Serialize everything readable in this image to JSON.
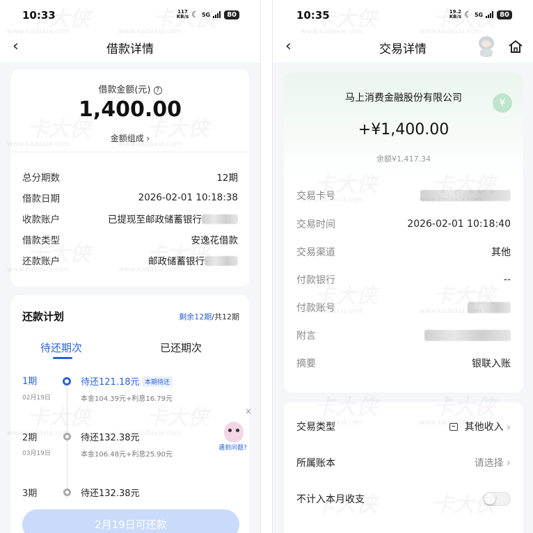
{
  "left": {
    "status": {
      "time": "10:33",
      "net_top": "117",
      "net_bottom": "KB/s",
      "sig": "5G",
      "battery": "80"
    },
    "nav": {
      "back_glyph": "‹",
      "title": "借款详情"
    },
    "amount": {
      "label": "借款金额(元)",
      "value": "1,400.00",
      "composition": "金额组成 ›"
    },
    "details": [
      {
        "k": "总分期数",
        "v": "12期"
      },
      {
        "k": "借款日期",
        "v": "2026-02-01 10:18:38"
      },
      {
        "k": "收款账户",
        "v": "已提现至邮政储蓄银行"
      },
      {
        "k": "借款类型",
        "v": "安逸花借款"
      },
      {
        "k": "还款账户",
        "v": "邮政储蓄银行"
      }
    ],
    "plan": {
      "title": "还款计划",
      "remaining": "剩余12期",
      "total": "/共12期",
      "tab_pending": "待还期次",
      "tab_paid": "已还期次",
      "items": [
        {
          "period": "1期",
          "date": "02月19日",
          "due": "待还121.18元",
          "badge": "本期待还",
          "principal": "本金104.39元",
          "interest": "+利息16.79元"
        },
        {
          "period": "2期",
          "date": "03月19日",
          "due": "待还132.38元",
          "badge": "",
          "principal": "本金106.48元",
          "interest": "+利息25.90元"
        },
        {
          "period": "3期",
          "date": "",
          "due": "待还132.38元",
          "badge": "",
          "principal": "",
          "interest": ""
        }
      ],
      "help": "遇到问题?",
      "help_close": "×",
      "button": "2月19日可还款"
    }
  },
  "right": {
    "status": {
      "time": "10:35",
      "net_top": "19.2",
      "net_bottom": "KB/s",
      "sig": "5G",
      "battery": "80"
    },
    "nav": {
      "back_glyph": "‹",
      "title": "交易详情",
      "home_icon": "home-icon"
    },
    "header": {
      "company": "马上消费金融股份有限公司",
      "amount": "+¥1,400.00",
      "balance": "余额¥1,417.34"
    },
    "fields": [
      {
        "k": "交易卡号",
        "v": ""
      },
      {
        "k": "交易时间",
        "v": "2026-02-01 10:18:40"
      },
      {
        "k": "交易渠道",
        "v": "其他"
      },
      {
        "k": "付款银行",
        "v": "--"
      },
      {
        "k": "付款账号",
        "v": ""
      },
      {
        "k": "附言",
        "v": ""
      },
      {
        "k": "摘要",
        "v": "银联入账"
      }
    ],
    "extra": {
      "type_label": "交易类型",
      "type_value": "其他收入",
      "book_label": "所属账本",
      "book_value": "请选择",
      "exclude_label": "不计入本月收支",
      "exclude_on": false
    }
  },
  "watermark": {
    "text": "卡大侠",
    "url": "www.kadaxia.com"
  },
  "colors": {
    "accent": "#2a63d8",
    "brand_green": "#25b36b"
  }
}
